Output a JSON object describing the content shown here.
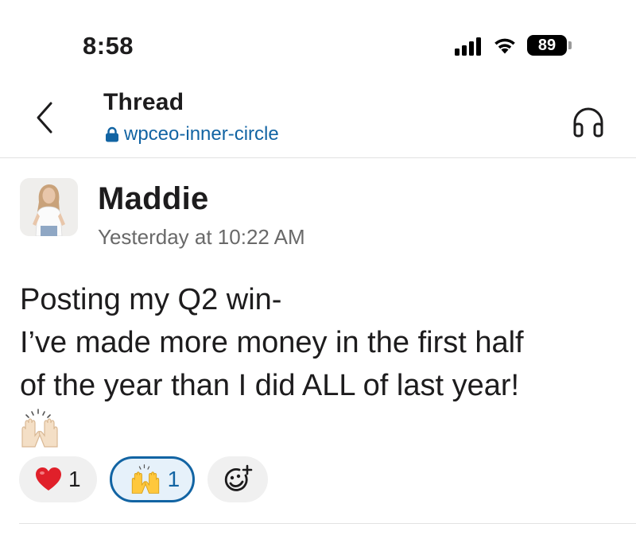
{
  "status_bar": {
    "time": "8:58",
    "battery": "89",
    "icons": [
      "signal-icon",
      "wifi-icon",
      "battery-icon"
    ]
  },
  "header": {
    "title": "Thread",
    "channel": "wpceo-inner-circle",
    "icons": [
      "back-chevron-icon",
      "lock-icon",
      "headphones-icon"
    ]
  },
  "message": {
    "author": "Maddie",
    "timestamp": "Yesterday at 10:22 AM",
    "lines": [
      "Posting my Q2 win-",
      "I’ve made more money in the first half",
      "of the year than I did ALL of last year!"
    ],
    "emoji_icon": "raised-hands-icon"
  },
  "reactions": [
    {
      "icon": "red-heart-icon",
      "count": "1",
      "active": false
    },
    {
      "icon": "raised-hands-icon",
      "count": "1",
      "active": true
    }
  ],
  "add_reaction_icon": "add-reaction-icon",
  "colors": {
    "link": "#1264a3",
    "text": "#1d1c1d",
    "muted": "#696969",
    "reaction_active_bg": "#e6f1fa",
    "reaction_bg": "#f0f0f0"
  }
}
